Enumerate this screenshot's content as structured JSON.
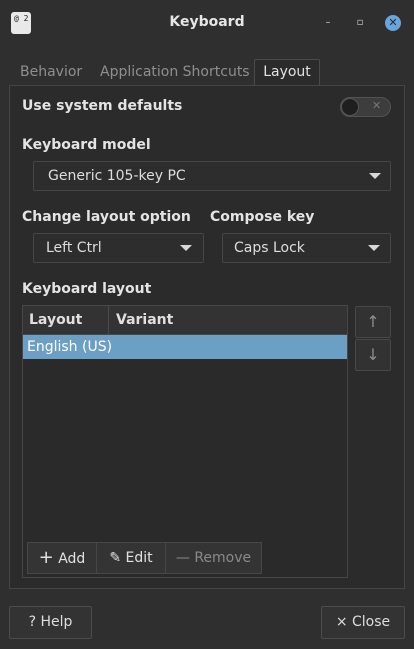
{
  "window": {
    "title": "Keyboard",
    "icon_text": "@ 2",
    "minimize_glyph": "–",
    "maximize_glyph": "▫",
    "close_glyph": "✕"
  },
  "tabs": [
    {
      "label": "Behavior",
      "active": false
    },
    {
      "label": "Application Shortcuts",
      "active": false
    },
    {
      "label": "Layout",
      "active": true
    }
  ],
  "layout_tab": {
    "use_system_defaults": {
      "label": "Use system defaults",
      "enabled": false,
      "toggle_glyph": "✕"
    },
    "keyboard_model": {
      "label": "Keyboard model",
      "value": "Generic 105-key PC"
    },
    "change_layout_option": {
      "label": "Change layout option",
      "value": "Left Ctrl"
    },
    "compose_key": {
      "label": "Compose key",
      "value": "Caps Lock"
    },
    "keyboard_layout": {
      "label": "Keyboard layout",
      "columns": [
        "Layout",
        "Variant"
      ],
      "rows": [
        {
          "layout": "English (US)",
          "variant": "",
          "selected": true
        }
      ]
    },
    "move_up_glyph": "↑",
    "move_down_glyph": "↓",
    "actions": {
      "add": {
        "icon": "+",
        "label": "Add"
      },
      "edit": {
        "icon": "✎",
        "label": "Edit"
      },
      "remove": {
        "icon": "—",
        "label": "Remove"
      }
    }
  },
  "footer": {
    "help": {
      "icon": "?",
      "label": "Help"
    },
    "close": {
      "icon": "×",
      "label": "Close"
    }
  },
  "colors": {
    "background": "#2f2f2f",
    "selection": "#6c9fc4",
    "close_button": "#6aa4d9"
  }
}
